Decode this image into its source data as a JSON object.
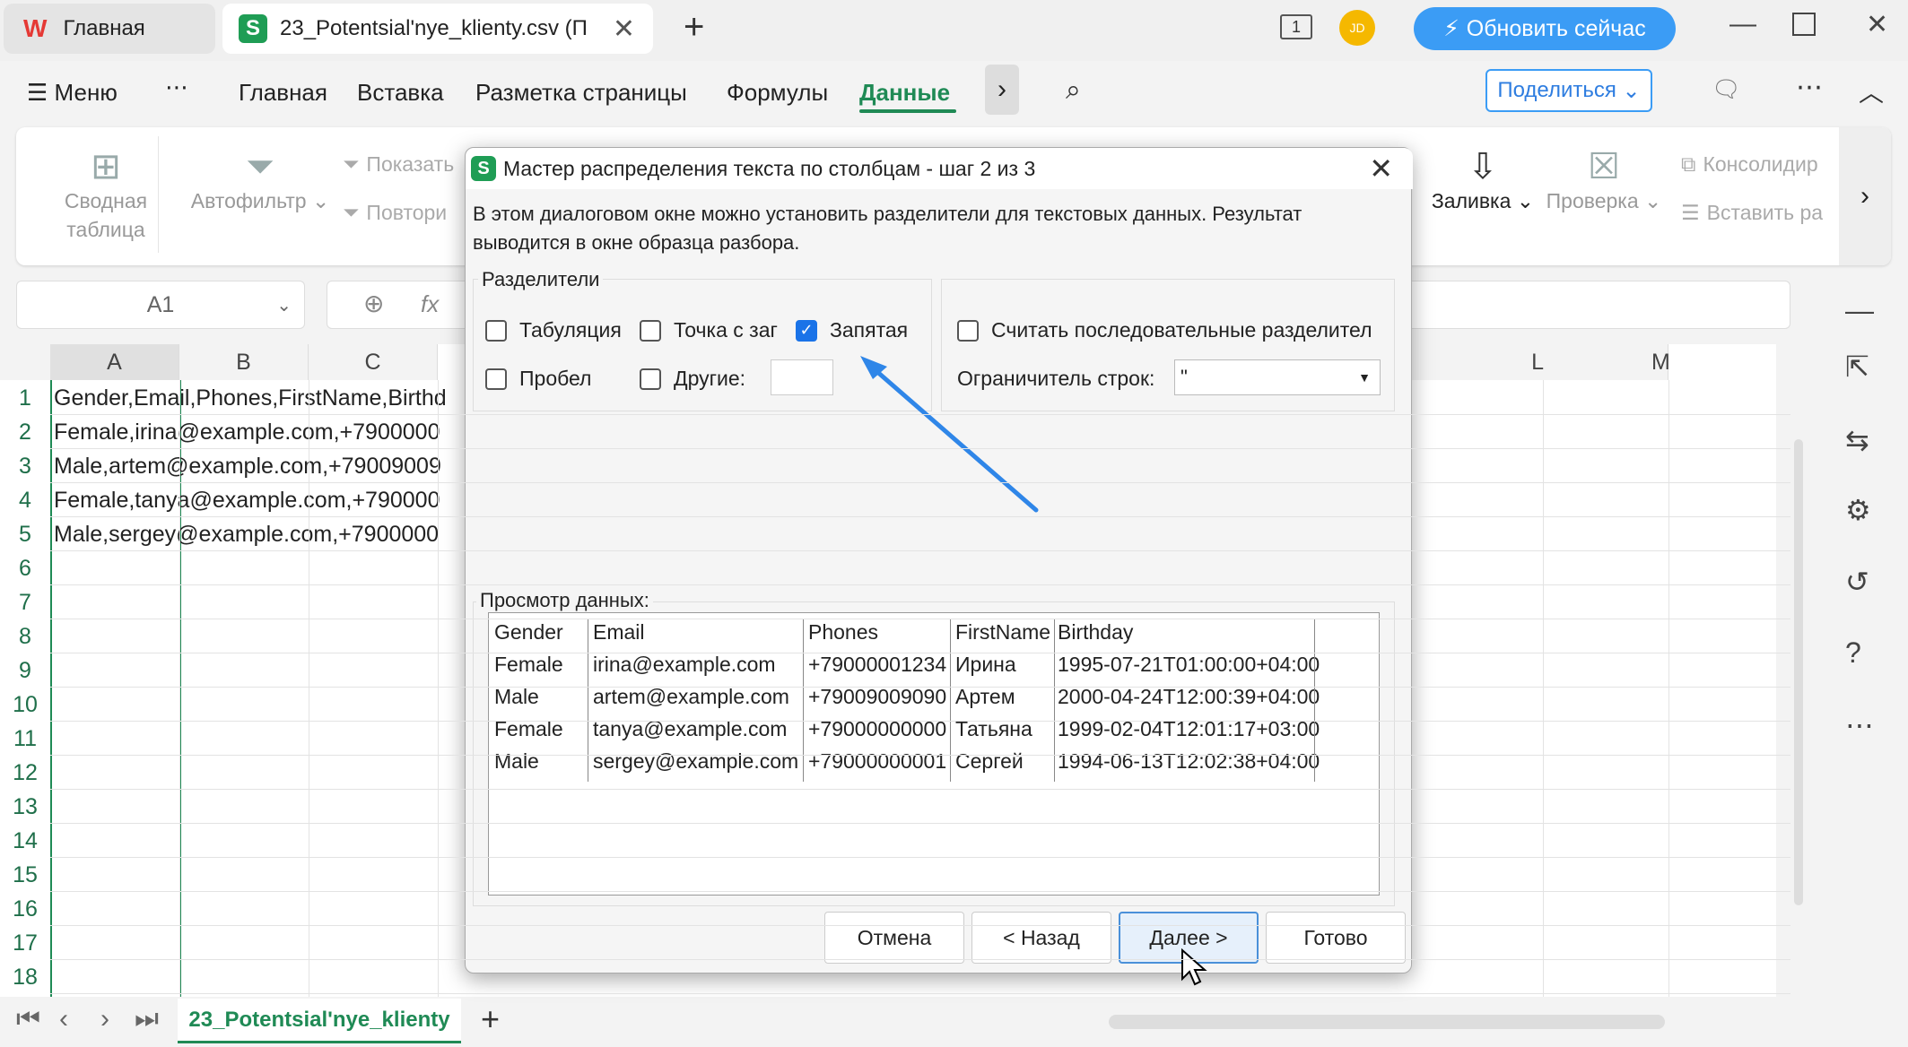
{
  "tabs": {
    "home": "Главная",
    "file": "23_Potentsial'nye_klienty.csv (П"
  },
  "topbar": {
    "update": "Обновить сейчас",
    "avatar": "JD",
    "page_count": "1"
  },
  "menu": {
    "menu": "Меню",
    "more": "⋯",
    "items": [
      "Главная",
      "Вставка",
      "Разметка страницы",
      "Формулы",
      "Данные"
    ],
    "share": "Поделиться"
  },
  "ribbon": {
    "pivot": "Сводная таблица",
    "autofilter": "Автофильтр",
    "show": "Показать",
    "repeat": "Повтори",
    "fill": "Заливка",
    "check": "Проверка",
    "consolidate": "Консолидир",
    "paste": "Вставить ра"
  },
  "namebox": "A1",
  "fx": "fx",
  "columns": [
    "A",
    "B",
    "C",
    "L",
    "M"
  ],
  "rows": [
    "1",
    "2",
    "3",
    "4",
    "5",
    "6",
    "7",
    "8",
    "9",
    "10",
    "11",
    "12",
    "13",
    "14",
    "15",
    "16",
    "17",
    "18"
  ],
  "cells": [
    "Gender,Email,Phones,FirstName,Birthd",
    "Female,irina@example.com,+7900000",
    "Male,artem@example.com,+79009009",
    "Female,tanya@example.com,+790000",
    "Male,sergey@example.com,+7900000"
  ],
  "sheet_tab": "23_Potentsial'nye_klienty",
  "dialog": {
    "title": "Мастер распределения текста по столбцам - шаг 2 из 3",
    "description": "В этом диалоговом окне можно установить разделители для текстовых данных. Результат выводится в окне образца разбора.",
    "delimiters_legend": "Разделители",
    "tab": "Табуляция",
    "semicolon": "Точка с заг",
    "comma": "Запятая",
    "space": "Пробел",
    "other": "Другие:",
    "consecutive": "Считать последовательные разделител",
    "qualifier_label": "Ограничитель строк:",
    "qualifier_value": "\"",
    "preview_label": "Просмотр данных:",
    "preview_headers": [
      "Gender",
      "Email",
      "Phones",
      "FirstName",
      "Birthday"
    ],
    "preview_rows": [
      [
        "Female",
        "irina@example.com",
        "+79000001234",
        "Ирина",
        "1995-07-21T01:00:00+04:00"
      ],
      [
        "Male",
        "artem@example.com",
        "+79009009090",
        "Артем",
        "2000-04-24T12:00:39+04:00"
      ],
      [
        "Female",
        "tanya@example.com",
        "+79000000000",
        "Татьяна",
        "1999-02-04T12:01:17+03:00"
      ],
      [
        "Male",
        "sergey@example.com",
        "+79000000001",
        "Сергей",
        "1994-06-13T12:02:38+04:00"
      ]
    ],
    "buttons": {
      "cancel": "Отмена",
      "back": "< Назад",
      "next": "Далее >",
      "finish": "Готово"
    }
  },
  "colors": {
    "accent": "#1f8a55",
    "blue": "#3b9cf5",
    "arrow": "#2f86e8"
  }
}
